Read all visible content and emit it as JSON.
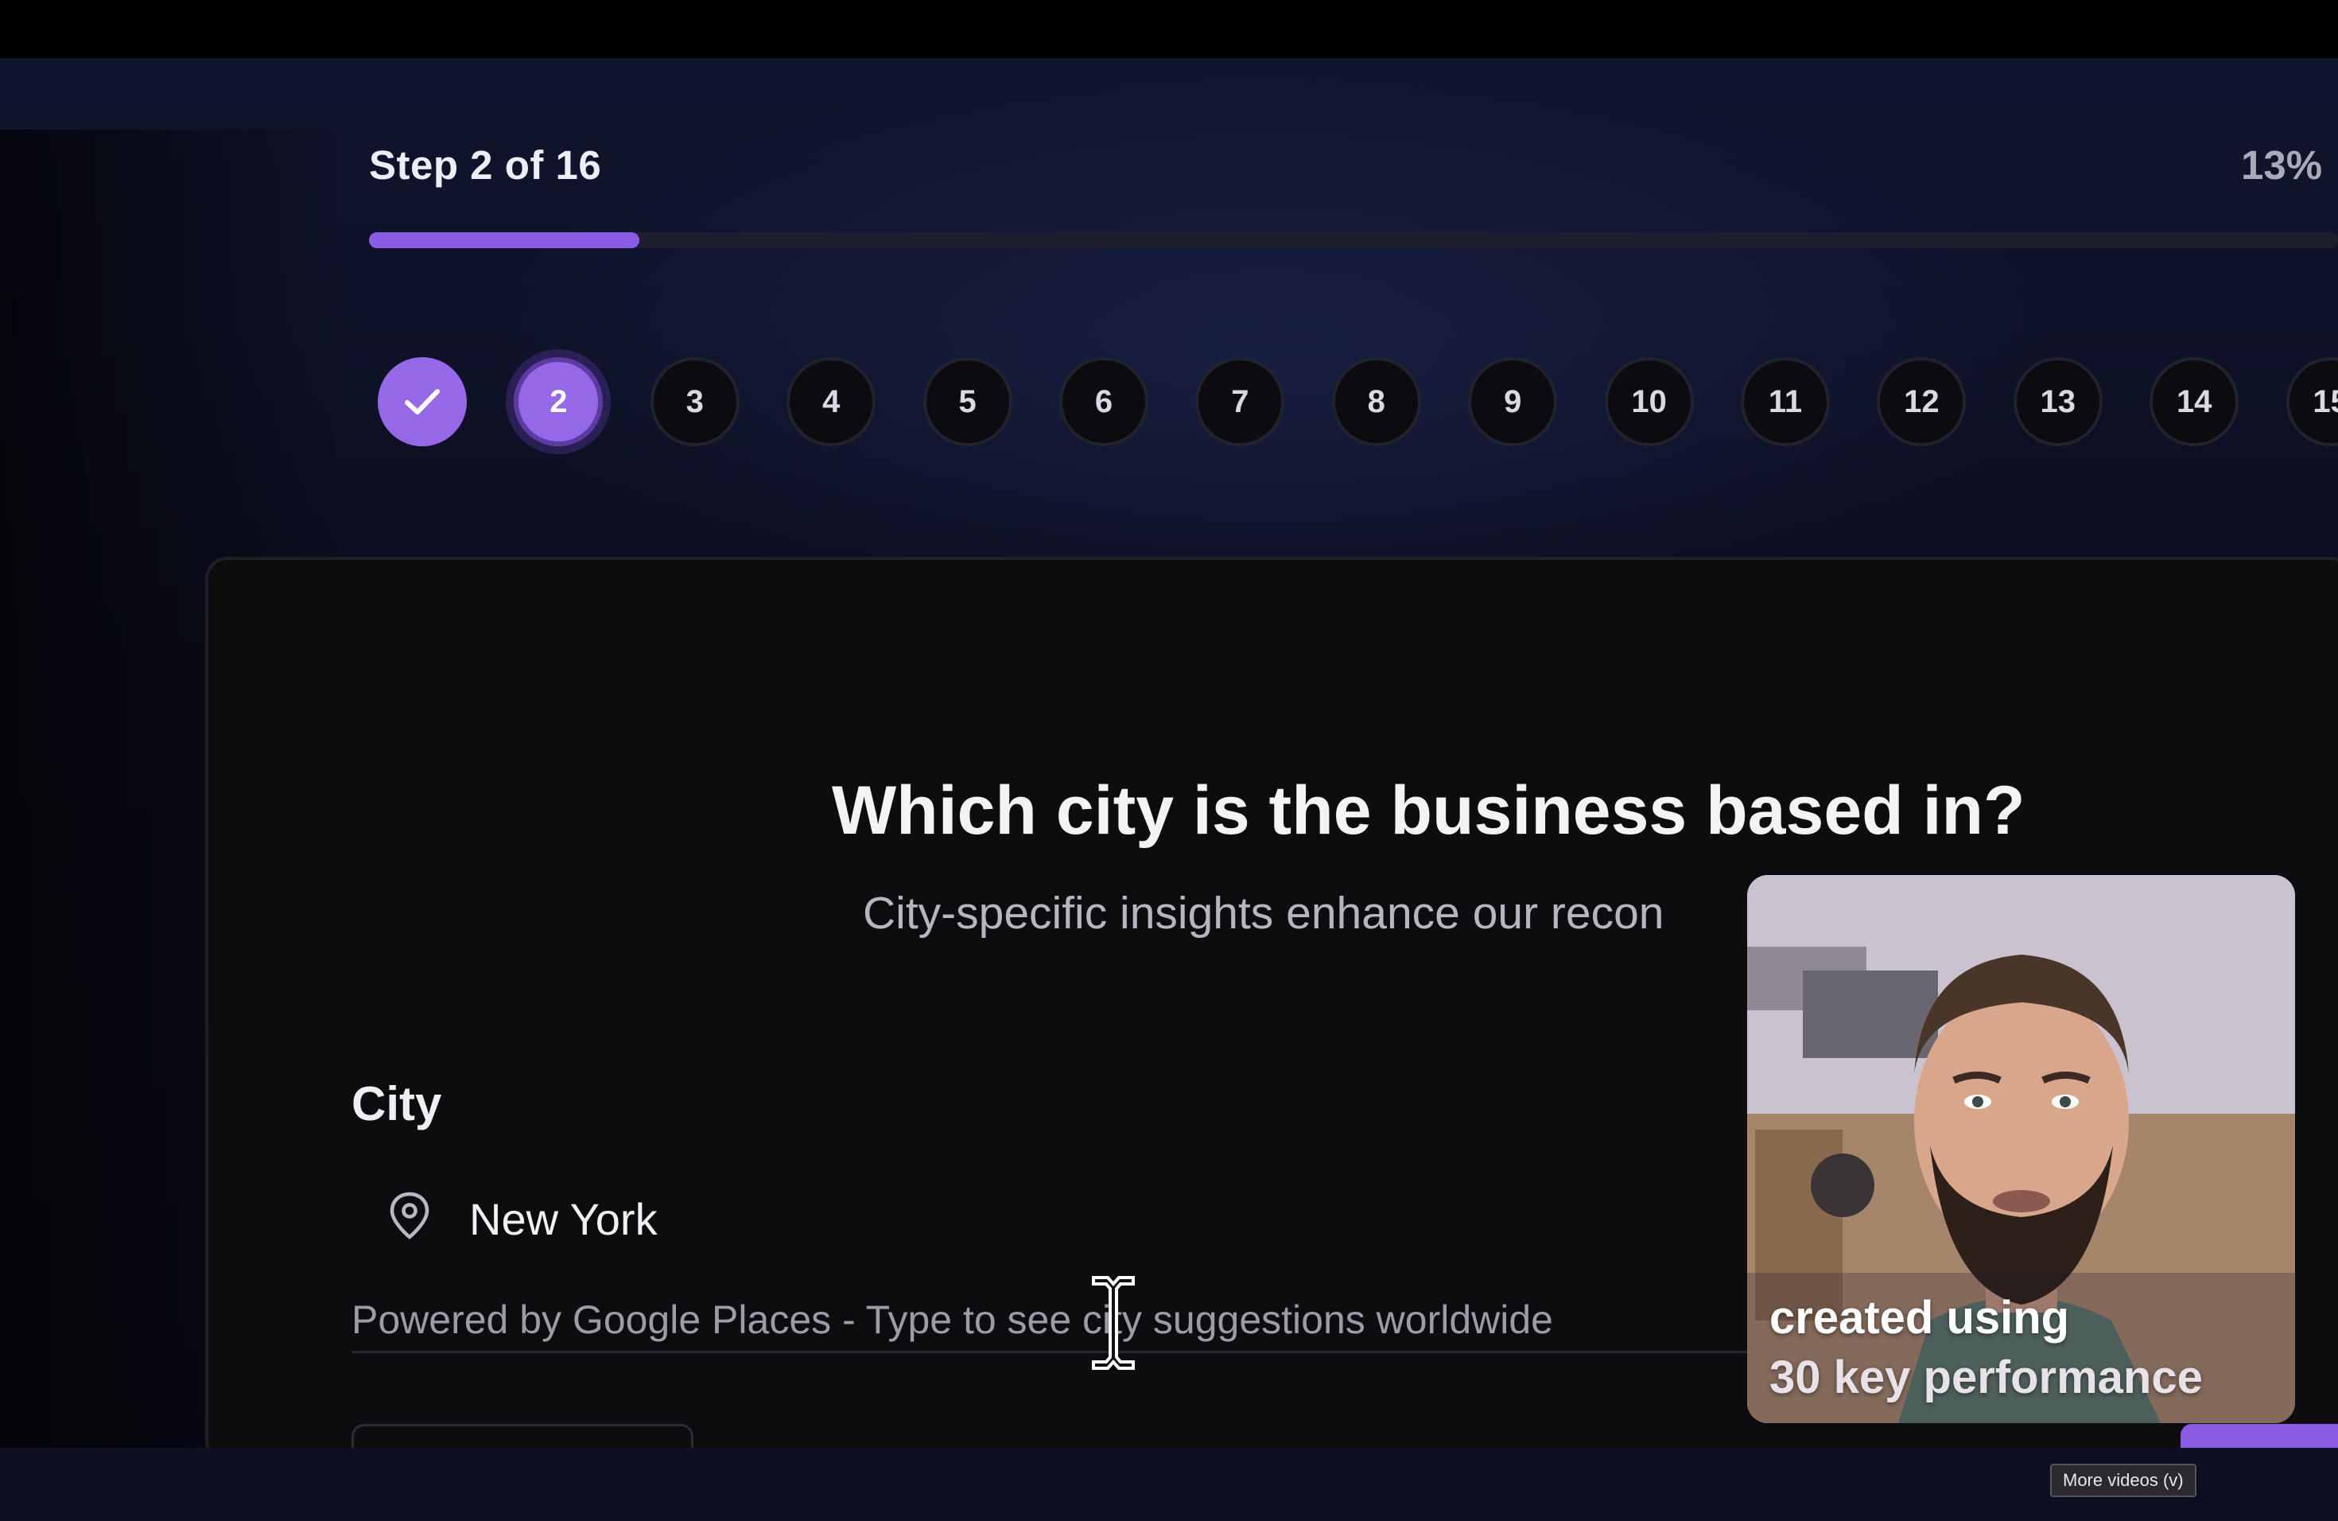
{
  "progress": {
    "step_text": "Step 2 of 16",
    "percent_text": "13%",
    "fraction": 0.13,
    "accent_color": "#8a5ce6"
  },
  "steps": [
    {
      "label": "",
      "state": "done"
    },
    {
      "label": "2",
      "state": "current"
    },
    {
      "label": "3",
      "state": "upcoming"
    },
    {
      "label": "4",
      "state": "upcoming"
    },
    {
      "label": "5",
      "state": "upcoming"
    },
    {
      "label": "6",
      "state": "upcoming"
    },
    {
      "label": "7",
      "state": "upcoming"
    },
    {
      "label": "8",
      "state": "upcoming"
    },
    {
      "label": "9",
      "state": "upcoming"
    },
    {
      "label": "10",
      "state": "upcoming"
    },
    {
      "label": "11",
      "state": "upcoming"
    },
    {
      "label": "12",
      "state": "upcoming"
    },
    {
      "label": "13",
      "state": "upcoming"
    },
    {
      "label": "14",
      "state": "upcoming"
    },
    {
      "label": "15",
      "state": "upcoming"
    }
  ],
  "question": {
    "title": "Which city is the business based in?",
    "subtitle": "City-specific insights enhance our recon"
  },
  "city_field": {
    "label": "City",
    "value": "New York",
    "helper": "Powered by Google Places - Type to see city suggestions worldwide"
  },
  "video_overlay": {
    "caption_line1": "created using",
    "caption_line2": "30 key performance"
  },
  "player": {
    "more_videos_tooltip": "More videos (v)"
  },
  "icons": {
    "checkmark": "checkmark-icon",
    "location": "map-pin-icon",
    "cursor": "text-cursor-icon"
  }
}
